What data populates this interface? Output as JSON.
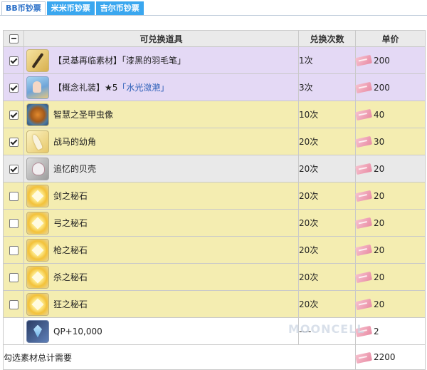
{
  "tabs": [
    {
      "label": "BB币钞票",
      "active": true
    },
    {
      "label": "米米币钞票",
      "active": false
    },
    {
      "label": "吉尔币钞票",
      "active": false
    }
  ],
  "table": {
    "headers": {
      "item": "可兑换道具",
      "count": "兑换次数",
      "price": "单价"
    },
    "rows": [
      {
        "checked": true,
        "icon": "quill-icon",
        "name_parts": [
          "【灵基再临素材】「漆黑的羽毛笔」"
        ],
        "count": "1次",
        "price": "200",
        "color": "#e4d9f5"
      },
      {
        "checked": true,
        "icon": "craft-essence-icon",
        "name_parts": [
          "【概念礼装】★5",
          "「水光潋滟」"
        ],
        "count": "3次",
        "price": "200",
        "color": "#e4d9f5"
      },
      {
        "checked": true,
        "icon": "scarab-icon",
        "name_parts": [
          "智慧之圣甲虫像"
        ],
        "count": "10次",
        "price": "40",
        "color": "#f4edb1"
      },
      {
        "checked": true,
        "icon": "horn-icon",
        "name_parts": [
          "战马的幼角"
        ],
        "count": "20次",
        "price": "30",
        "color": "#f4edb1"
      },
      {
        "checked": true,
        "icon": "shell-icon",
        "name_parts": [
          "追忆的贝壳"
        ],
        "count": "20次",
        "price": "20",
        "color": "#e9e9e9"
      },
      {
        "checked": false,
        "icon": "gem-icon",
        "name_parts": [
          "剑之秘石"
        ],
        "count": "20次",
        "price": "20",
        "color": "#f4edb1"
      },
      {
        "checked": false,
        "icon": "gem-icon",
        "name_parts": [
          "弓之秘石"
        ],
        "count": "20次",
        "price": "20",
        "color": "#f4edb1"
      },
      {
        "checked": false,
        "icon": "gem-icon",
        "name_parts": [
          "枪之秘石"
        ],
        "count": "20次",
        "price": "20",
        "color": "#f4edb1"
      },
      {
        "checked": false,
        "icon": "gem-icon",
        "name_parts": [
          "杀之秘石"
        ],
        "count": "20次",
        "price": "20",
        "color": "#f4edb1"
      },
      {
        "checked": false,
        "icon": "gem-icon",
        "name_parts": [
          "狂之秘石"
        ],
        "count": "20次",
        "price": "20",
        "color": "#f4edb1"
      },
      {
        "checked": null,
        "icon": "qp-icon",
        "name_parts": [
          "QP+10,000"
        ],
        "count": "----",
        "price": "2",
        "color": "#ffffff"
      }
    ],
    "total": {
      "label": "勾选素材总计需要",
      "price": "2200"
    }
  },
  "watermark": "MOONCELL",
  "price_icon": "ticket-icon"
}
